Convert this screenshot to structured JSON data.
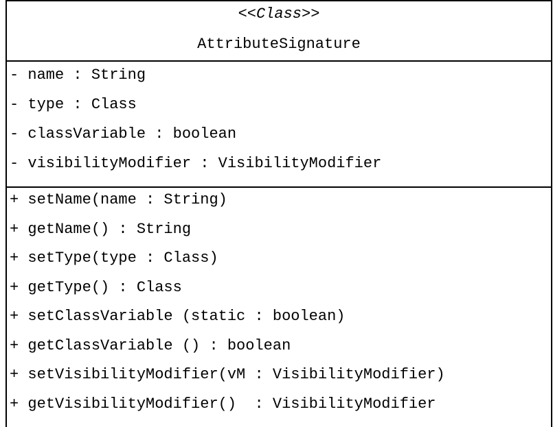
{
  "class_box": {
    "stereotype": "<<Class>>",
    "name": "AttributeSignature",
    "attributes": [
      "- name : String",
      "- type : Class",
      "- classVariable : boolean",
      "- visibilityModifier : VisibilityModifier"
    ],
    "operations": [
      "+ setName(name : String)",
      "+ getName() : String",
      "+ setType(type : Class)",
      "+ getType() : Class",
      "+ setClassVariable (static : boolean)",
      "+ getClassVariable () : boolean",
      "+ setVisibilityModifier(vM : VisibilityModifier)",
      "+ getVisibilityModifier()  : VisibilityModifier"
    ]
  }
}
